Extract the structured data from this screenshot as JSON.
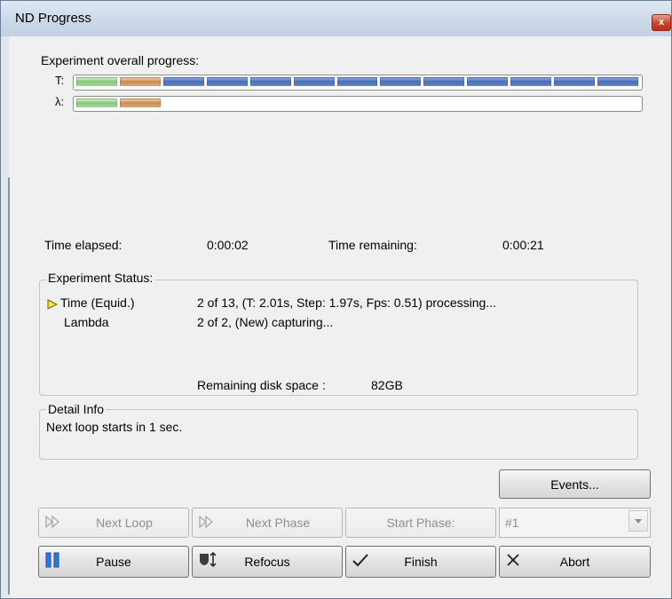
{
  "window": {
    "title": "ND Progress",
    "close_glyph": "x"
  },
  "progress": {
    "heading": "Experiment overall progress:",
    "time_label": "T:",
    "lambda_label": "λ:",
    "time_segments": [
      "done",
      "current",
      "pending",
      "pending",
      "pending",
      "pending",
      "pending",
      "pending",
      "pending",
      "pending",
      "pending",
      "pending",
      "pending"
    ],
    "lambda_segments": [
      "done",
      "current"
    ],
    "colors": {
      "done": "#80c877",
      "current": "#cc8a52",
      "pending": "#4a6fb9"
    }
  },
  "timing": {
    "elapsed_label": "Time elapsed:",
    "elapsed_value": "0:00:02",
    "remaining_label": "Time remaining:",
    "remaining_value": "0:00:21"
  },
  "status": {
    "title": "Experiment Status:",
    "rows": [
      {
        "name": "Time (Equid.)",
        "detail": "2 of 13, (T: 2.01s, Step: 1.97s, Fps: 0.51) processing...",
        "active": true
      },
      {
        "name": "Lambda",
        "detail": "2 of 2, (New) capturing...",
        "active": false
      }
    ],
    "disk_label": "Remaining disk space :",
    "disk_value": "82GB"
  },
  "detail": {
    "title": "Detail Info",
    "text": "Next loop starts in 1 sec."
  },
  "buttons": {
    "events": "Events...",
    "next_loop": "Next Loop",
    "next_phase": "Next Phase",
    "start_phase": "Start Phase:",
    "phase_select": "#1",
    "pause": "Pause",
    "refocus": "Refocus",
    "finish": "Finish",
    "abort": "Abort"
  }
}
